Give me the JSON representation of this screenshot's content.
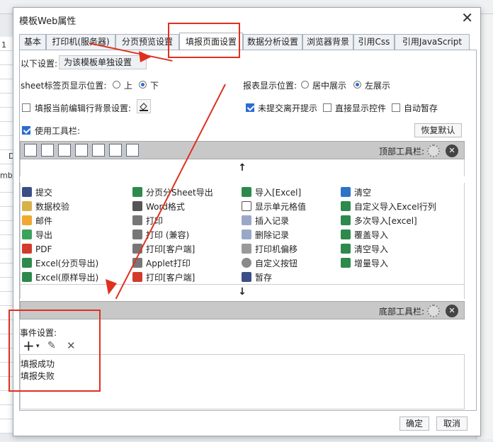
{
  "window": {
    "title": "模板Web属性",
    "close_glyph": "✕"
  },
  "background": {
    "left_column_top": "1",
    "left_cell_1": "D",
    "left_cell_2": "mbe"
  },
  "tabs": [
    {
      "label": "基本",
      "active": false
    },
    {
      "label": "打印机(服务器)",
      "active": false
    },
    {
      "label": "分页预览设置",
      "active": false
    },
    {
      "label": "填报页面设置",
      "active": true
    },
    {
      "label": "数据分析设置",
      "active": false
    },
    {
      "label": "浏览器背景",
      "active": false
    },
    {
      "label": "引用Css",
      "active": false
    },
    {
      "label": "引用JavaScript",
      "active": false
    }
  ],
  "settings": {
    "scope_label": "以下设置:",
    "scope_value": "为该模板单独设置",
    "sheet_position_label": "sheet标签页显示位置:",
    "sheet_position_options": [
      "上",
      "下"
    ],
    "sheet_position_selected": "下",
    "report_position_label": "报表显示位置:",
    "report_position_options": [
      "居中展示",
      "左展示"
    ],
    "report_position_selected": "左展示",
    "bg_row_label": "填报当前编辑行背景设置:",
    "bg_row_checked": false,
    "unsubmitted_label": "未提交离开提示",
    "unsubmitted_checked": true,
    "show_widget_label": "直接显示控件",
    "show_widget_checked": false,
    "autosave_label": "自动暂存",
    "autosave_checked": false,
    "use_toolbar_label": "使用工具栏:",
    "use_toolbar_checked": true,
    "restore_button": "恢复默认"
  },
  "top_toolbar": {
    "label": "顶部工具栏:",
    "up_arrow": "↑"
  },
  "bottom_toolbar": {
    "label": "底部工具栏:",
    "down_arrow": "↓"
  },
  "buttons_grid": [
    [
      "提交",
      "分页分Sheet导出",
      "导入[Excel]",
      "清空"
    ],
    [
      "数据校验",
      "Word格式",
      "显示单元格值",
      "自定义导入Excel行列"
    ],
    [
      "邮件",
      "打印",
      "插入记录",
      "多次导入[excel]"
    ],
    [
      "导出",
      "打印 (兼容)",
      "删除记录",
      "覆盖导入"
    ],
    [
      "PDF",
      "打印[客户端]",
      "打印机偏移",
      "清空导入"
    ],
    [
      "Excel(分页导出)",
      "Applet打印",
      "自定义按钮",
      "增量导入"
    ],
    [
      "Excel(原样导出)",
      "打印[客户端]",
      "暂存",
      ""
    ]
  ],
  "events": {
    "label": "事件设置:",
    "items": [
      "填报成功",
      "填报失败"
    ]
  },
  "footer": {
    "ok": "确定",
    "cancel": "取消"
  },
  "colors": {
    "accent": "#2b6cd2",
    "annotation": "#e0301e"
  }
}
